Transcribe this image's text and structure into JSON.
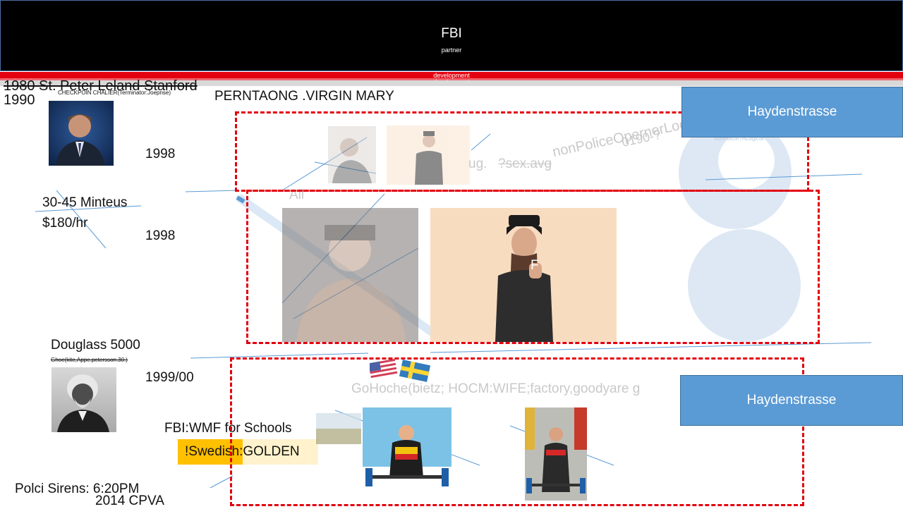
{
  "header": {
    "title": "FBI",
    "subtitle": "partner"
  },
  "dev_labels": [
    "development",
    "development"
  ],
  "left_col": {
    "line1": "1980 St. Peter Leland Stanford",
    "line2": "1990",
    "caption1": "CHECKPOIN CHALIER(Terminator:Joepnse)",
    "year_a": "1998",
    "year_b": "1998",
    "minutes": "30-45 Minteus",
    "rate": "$180/hr",
    "douglass": "Douglass 5000",
    "caption2": "Ghoe(kite,Appe.petersson.30.)",
    "year_c": "1999/00",
    "fbi_wmf": "FBI:WMF for Schools",
    "swedish": "!Swedish:GOLDEN",
    "sirens": "Polci Sirens: 6:20PM",
    "cpva": "2014 CPVA"
  },
  "center": {
    "heading": "PERNTAONG .VIRGIN MARY",
    "faded_aug": "ug.",
    "faded_sex": "?sex.avg",
    "faded_rot1": "nonPoliceOpernerLogical",
    "faded_rot2": "0190-?",
    "faded_small": "nonPolcie?ALogical",
    "faded_all": "All",
    "faded_bottom": "GoHoche(bietz; HOCM:WIFE;factory,goodyare g",
    "faded_f": "F"
  },
  "buttons": {
    "top": "Haydenstrasse",
    "bottom": "Haydenstrasse"
  },
  "colors": {
    "red": "#e3000f",
    "blue": "#5b9bd5",
    "gold": "#ffc000"
  }
}
